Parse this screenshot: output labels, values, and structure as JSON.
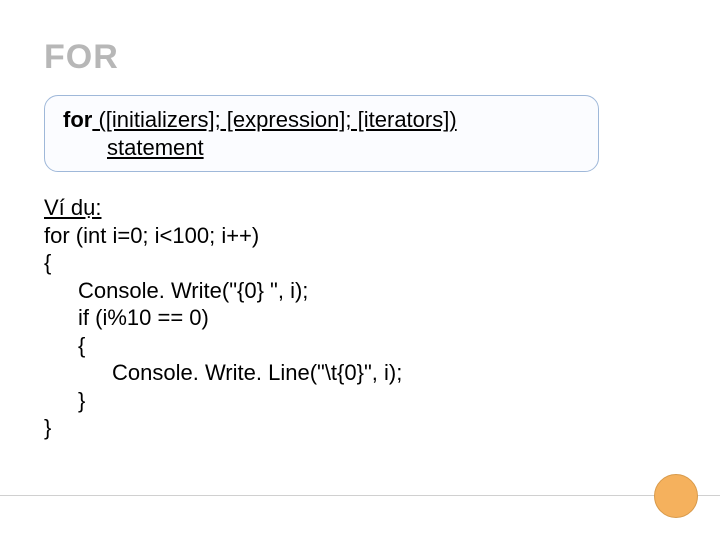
{
  "title": "FOR",
  "syntax": {
    "keyword": "for",
    "rest": " ([initializers]; [expression]; [iterators])",
    "statement": "statement"
  },
  "example": {
    "label": "Ví dụ:",
    "line_for": "for (int i=0; i<100; i++)",
    "line_openbrace": "{",
    "line_write": "Console. Write(\"{0} \", i);",
    "line_if": "if (i%10 == 0)",
    "line_openbrace2": "{",
    "line_writeline": "Console. Write. Line(\"\\t{0}\", i);",
    "line_closebrace2": "}",
    "line_closebrace": "}"
  }
}
